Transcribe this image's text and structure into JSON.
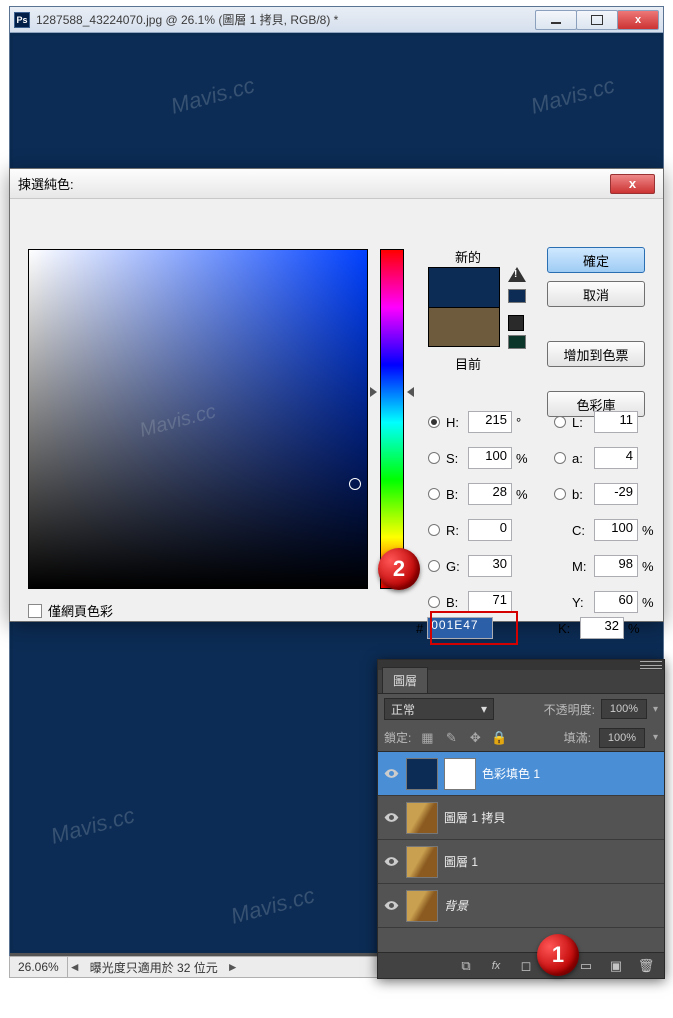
{
  "window": {
    "title": "1287588_43224070.jpg @ 26.1% (圖層 1 拷貝, RGB/8) *",
    "icon_text": "Ps"
  },
  "watermark": "Mavis.cc",
  "dialog": {
    "title": "揀選純色:",
    "new_label": "新的",
    "current_label": "目前",
    "ok": "確定",
    "cancel": "取消",
    "add_swatch": "增加到色票",
    "libraries": "色彩庫",
    "web_only": "僅網頁色彩",
    "values": {
      "H": "215",
      "H_unit": "°",
      "S": "100",
      "S_unit": "%",
      "Bv": "28",
      "Bv_unit": "%",
      "R": "0",
      "G": "30",
      "Bc": "71",
      "L": "11",
      "a": "4",
      "b": "-29",
      "C": "100",
      "C_unit": "%",
      "M": "98",
      "M_unit": "%",
      "Y": "60",
      "Y_unit": "%",
      "K": "32",
      "K_unit": "%"
    },
    "hex_label": "#",
    "hex": "001E47",
    "colors": {
      "new": "#0c2c55",
      "current": "#6e5a3c"
    }
  },
  "markers": {
    "one": "1",
    "two": "2"
  },
  "layers_panel": {
    "tab": "圖層",
    "blend_mode": "正常",
    "opacity_label": "不透明度:",
    "opacity": "100%",
    "lock_label": "鎖定:",
    "fill_label": "填滿:",
    "fill": "100%",
    "layers": [
      {
        "name": "色彩填色 1"
      },
      {
        "name": "圖層 1 拷貝"
      },
      {
        "name": "圖層 1"
      },
      {
        "name": "背景"
      }
    ],
    "footer_fx": "fx"
  },
  "statusbar": {
    "zoom": "26.06%",
    "msg": "曝光度只適用於 32 位元"
  }
}
